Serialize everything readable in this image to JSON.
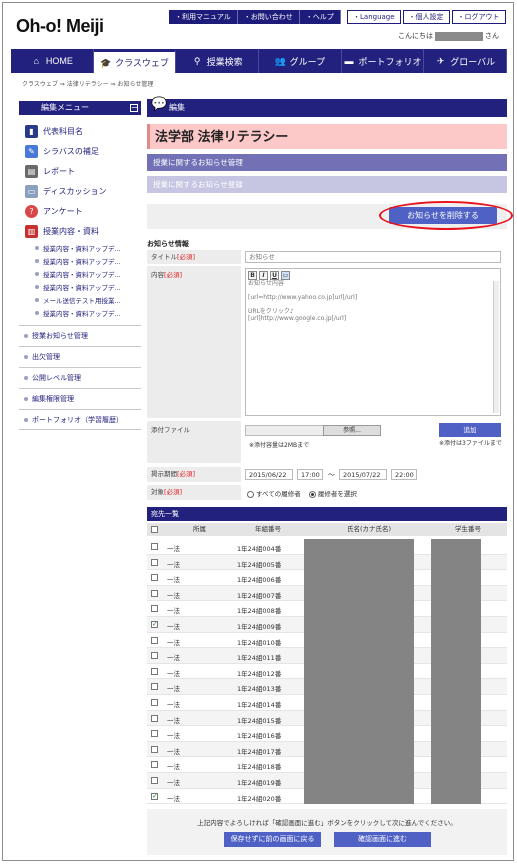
{
  "header": {
    "logo": "Oh-o! Meiji",
    "top_links": [
      "・利用マニュアル",
      "・お問い合わせ",
      "・ヘルプ"
    ],
    "top_buttons": [
      "・Language",
      "・個人設定",
      "・ログアウト"
    ],
    "greeting_prefix": "こんにちは",
    "greeting_suffix": "さん"
  },
  "main_nav": [
    {
      "label": "HOME",
      "icon": "house-icon",
      "glyph": "⌂"
    },
    {
      "label": "クラスウェブ",
      "icon": "mortarboard-icon",
      "glyph": "🎓"
    },
    {
      "label": "授業検索",
      "icon": "magnifier-icon",
      "glyph": "⚲"
    },
    {
      "label": "グループ",
      "icon": "people-icon",
      "glyph": "👥"
    },
    {
      "label": "ポートフォリオ",
      "icon": "folder-icon",
      "glyph": "▬"
    },
    {
      "label": "グローバル",
      "icon": "airplane-icon",
      "glyph": "✈"
    }
  ],
  "breadcrumb": "クラスウェブ ⇒ 法律リテラシー ⇒ お知らせ管理",
  "sidebar": {
    "title": "編集メニュー",
    "collapse": "−",
    "items": [
      {
        "label": "代表科目名",
        "icon": "book-icon",
        "color": "#2a3a8a",
        "glyph": "▮"
      },
      {
        "label": "シラバスの補足",
        "icon": "pencil-icon",
        "color": "#4a7ad8",
        "glyph": "✎"
      },
      {
        "label": "レポート",
        "icon": "document-icon",
        "color": "#6a6a6a",
        "glyph": "▤"
      },
      {
        "label": "ディスカッション",
        "icon": "monitor-icon",
        "color": "#8aa0c0",
        "glyph": "▭"
      },
      {
        "label": "アンケート",
        "icon": "qa-icon",
        "color": "#d84848",
        "glyph": "?"
      },
      {
        "label": "授業内容・資料",
        "icon": "notebook-icon",
        "color": "#c83030",
        "glyph": "▥"
      }
    ],
    "subitems": [
      "授業内容・資料アップデ...",
      "授業内容・資料アップデ...",
      "授業内容・資料アップデ...",
      "授業内容・資料アップデ...",
      "メール送信テスト用授業...",
      "授業内容・資料アップデ..."
    ],
    "links": [
      "授業お知らせ管理",
      "出欠管理",
      "公開レベル管理",
      "編集権限管理",
      "ポートフォリオ（学習履歴）"
    ]
  },
  "edit": {
    "header": "編集",
    "course_title": "法学部 法律リテラシー",
    "sub1": "授業に関するお知らせ管理",
    "sub2": "授業に関するお知らせ登録",
    "delete_button": "お知らせを削除する"
  },
  "form": {
    "section": "お知らせ情報",
    "required": "[必須]",
    "title_label": "タイトル",
    "title_value": "お知らせ",
    "content_label": "内容",
    "editor_tools": [
      "B",
      "I",
      "U",
      "▭"
    ],
    "content_value": "お知らせ内容\n\n[url=http://www.yahoo.co.jp]url[/url]\n\nURLをクリック♪\n[url]http://www.google.co.jp[/url]",
    "attach_label": "添付ファイル",
    "browse": "参照...",
    "attach_note": "※添付容量は2MBまで",
    "add_button": "追加",
    "add_note": "※添付は3ファイルまで",
    "period_label": "掲示期間",
    "date_from": "2015/06/22",
    "time_from": "17:00",
    "tilde": "〜",
    "date_to": "2015/07/22",
    "time_to": "22:00",
    "target_label": "対象",
    "target_all": "すべての履修者",
    "target_select": "履修者を選択"
  },
  "recipients": {
    "title": "宛先一覧",
    "columns": [
      "所属",
      "年組番号",
      "氏名(カナ氏名)",
      "学生番号"
    ],
    "rows": [
      {
        "checked": false,
        "dept": "一法",
        "num": "1年24組004番"
      },
      {
        "checked": false,
        "dept": "一法",
        "num": "1年24組005番"
      },
      {
        "checked": false,
        "dept": "一法",
        "num": "1年24組006番"
      },
      {
        "checked": false,
        "dept": "一法",
        "num": "1年24組007番"
      },
      {
        "checked": false,
        "dept": "一法",
        "num": "1年24組008番"
      },
      {
        "checked": true,
        "dept": "一法",
        "num": "1年24組009番"
      },
      {
        "checked": false,
        "dept": "一法",
        "num": "1年24組010番"
      },
      {
        "checked": false,
        "dept": "一法",
        "num": "1年24組011番"
      },
      {
        "checked": false,
        "dept": "一法",
        "num": "1年24組012番"
      },
      {
        "checked": false,
        "dept": "一法",
        "num": "1年24組013番"
      },
      {
        "checked": false,
        "dept": "一法",
        "num": "1年24組014番"
      },
      {
        "checked": false,
        "dept": "一法",
        "num": "1年24組015番"
      },
      {
        "checked": false,
        "dept": "一法",
        "num": "1年24組016番"
      },
      {
        "checked": false,
        "dept": "一法",
        "num": "1年24組017番"
      },
      {
        "checked": false,
        "dept": "一法",
        "num": "1年24組018番"
      },
      {
        "checked": false,
        "dept": "一法",
        "num": "1年24組019番"
      },
      {
        "checked": true,
        "dept": "一法",
        "num": "1年24組020番"
      }
    ]
  },
  "footer": {
    "message": "上記内容でよろしければ「確認画面に進む」ボタンをクリックして次に進んでください。",
    "back_button": "保存せずに前の画面に戻る",
    "next_button": "確認画面に進む"
  }
}
